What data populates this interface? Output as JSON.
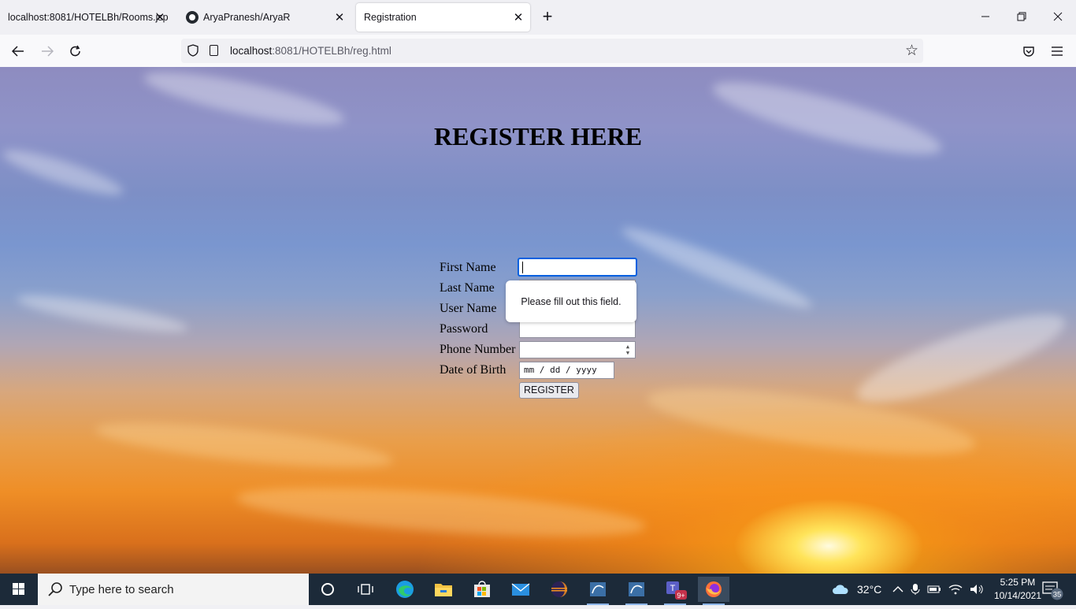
{
  "browser": {
    "tabs": [
      {
        "title": "localhost:8081/HOTELBh/Rooms.jsp"
      },
      {
        "title": "AryaPranesh/AryaR"
      },
      {
        "title": "Registration"
      }
    ],
    "url_host": "localhost",
    "url_rest": ":8081/HOTELBh/reg.html"
  },
  "page": {
    "heading": "REGISTER HERE",
    "form": {
      "first_name_label": "First Name",
      "last_name_label": "Last Name",
      "user_name_label": "User Name",
      "password_label": "Password",
      "phone_label": "Phone Number",
      "dob_label": "Date of Birth",
      "dob_placeholder": "mm / dd / yyyy",
      "submit_label": "REGISTER"
    },
    "validation_tooltip": "Please fill out this field."
  },
  "taskbar": {
    "search_placeholder": "Type here to search",
    "weather": "32°C",
    "time": "5:25 PM",
    "date": "10/14/2021",
    "teams_badge": "9+",
    "notifications_count": "35"
  },
  "colors": {
    "accent": "#0060df",
    "taskbar": "#1c2a39"
  }
}
